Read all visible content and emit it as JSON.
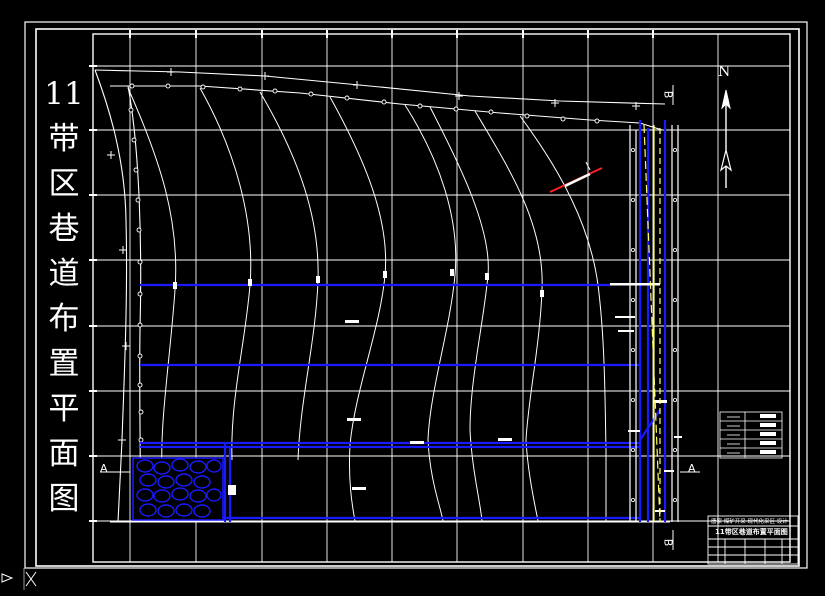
{
  "drawing": {
    "title_chars": [
      "11",
      "带",
      "区",
      "巷",
      "道",
      "布",
      "置",
      "平",
      "面",
      "图"
    ],
    "north_label": "N",
    "section_marks": {
      "a_left": "A",
      "a_right": "A",
      "b_top": "B",
      "b_bottom": "B"
    },
    "title_block": {
      "line1": "唐家 煤矿开采 现代化采区 设计",
      "line2": "11带区巷道布置平面图"
    }
  },
  "colors": {
    "background": "#000000",
    "frame": "#ffffff",
    "roadway": "#1a1aff",
    "contour": "#ffffff",
    "highlight": "#ffff66",
    "accent": "#ff2020"
  },
  "icons": [
    "north-arrow-icon",
    "crosshair-icon"
  ]
}
